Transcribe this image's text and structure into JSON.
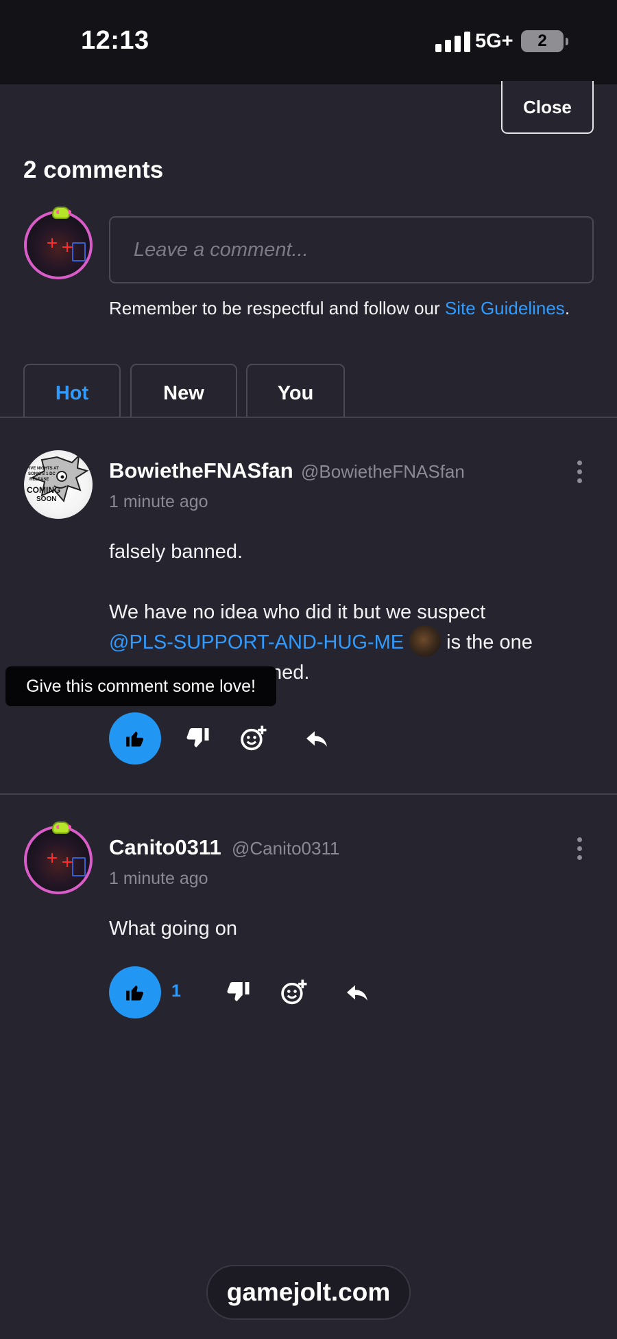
{
  "status_bar": {
    "time": "12:13",
    "network": "5G+",
    "battery": "2"
  },
  "close_label": "Close",
  "comments_title": "2 comments",
  "input": {
    "placeholder": "Leave a comment..."
  },
  "guidelines": {
    "text": "Remember to be respectful and follow our ",
    "link": "Site Guidelines",
    "end": "."
  },
  "tabs": [
    {
      "label": "Hot",
      "active": true
    },
    {
      "label": "New",
      "active": false
    },
    {
      "label": "You",
      "active": false
    }
  ],
  "comments": [
    {
      "username": "BowietheFNASfan",
      "handle": "@BowietheFNASfan",
      "time_ago": "1 minute ago",
      "line1": "falsely banned.",
      "line2": "We have no idea who did it but we suspect",
      "mention": "@PLS-SUPPORT-AND-HUG-ME",
      "line3_end": "is the one",
      "line4_visible": "ned.",
      "like_count": ""
    },
    {
      "username": "Canito0311",
      "handle": "@Canito0311",
      "time_ago": "1 minute ago",
      "line1": "What going on",
      "like_count": "1"
    }
  ],
  "tooltip": "Give this comment some love!",
  "avatar_badge_text": [
    "FIVE NIGHTS AT",
    "SONIC'S 1 DC",
    "RELEASE",
    "COMING",
    "SOON"
  ],
  "footer_domain": "gamejolt.com",
  "colors": {
    "background": "#26252f",
    "accent": "#2196f3",
    "link": "#2f9bff",
    "avatar_ring": "#d95cc9"
  }
}
